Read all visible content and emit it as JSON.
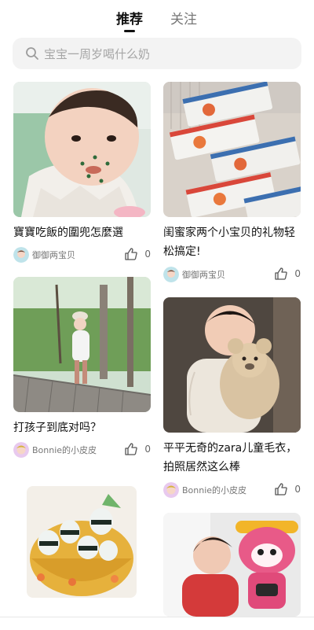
{
  "tabs": {
    "recommend": "推荐",
    "follow": "关注"
  },
  "search": {
    "placeholder": "宝宝一周岁喝什么奶"
  },
  "cards": [
    {
      "title": "寶寶吃飯的圍兜怎麼選",
      "author": "御御两宝贝",
      "likes": "0"
    },
    {
      "title": "闺蜜家两个小宝贝的礼物轻松搞定!",
      "author": "御御两宝贝",
      "likes": "0"
    },
    {
      "title": "打孩子到底对吗？",
      "author": "Bonnie的小皮皮",
      "likes": "0"
    },
    {
      "title": "平平无奇的zara儿童毛衣，拍照居然这么棒",
      "author": "Bonnie的小皮皮",
      "likes": "0"
    }
  ],
  "colors": {
    "accent": "#111111",
    "muted": "#777777",
    "search_bg": "#f3f3f3"
  },
  "icons": [
    "search-icon",
    "thumbs-up-icon",
    "avatar-icon"
  ]
}
